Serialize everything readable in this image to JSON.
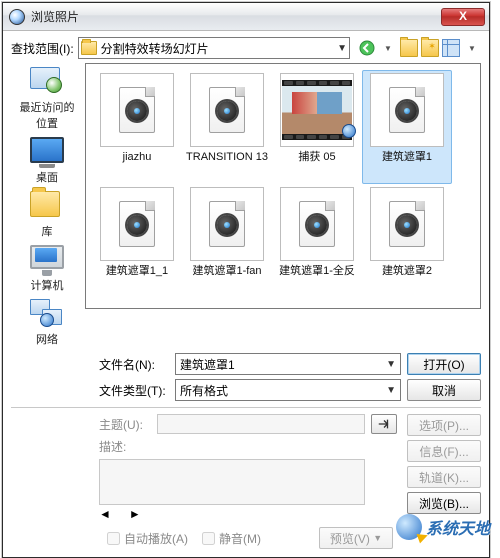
{
  "title": "浏览照片",
  "lookin": {
    "label": "查找范围(I):",
    "folder": "分割特效转场幻灯片"
  },
  "places": {
    "recent": "最近访问的位置",
    "desktop": "桌面",
    "libraries": "库",
    "computer": "计算机",
    "network": "网络"
  },
  "files": [
    {
      "label": "jiazhu",
      "type": "doc"
    },
    {
      "label": "TRANSITION 13",
      "type": "doc"
    },
    {
      "label": "捕获 05",
      "type": "video"
    },
    {
      "label": "建筑遮罩1",
      "type": "doc",
      "selected": true
    },
    {
      "label": "建筑遮罩1_1",
      "type": "doc"
    },
    {
      "label": "建筑遮罩1-fan",
      "type": "doc"
    },
    {
      "label": "建筑遮罩1-全反",
      "type": "doc"
    },
    {
      "label": "建筑遮罩2",
      "type": "doc"
    }
  ],
  "filename_label": "文件名(N):",
  "filename_value": "建筑遮罩1",
  "filetype_label": "文件类型(T):",
  "filetype_value": "所有格式",
  "open_btn": "打开(O)",
  "cancel_btn": "取消",
  "subject_label": "主题(U):",
  "desc_label": "描述:",
  "options_btn": "选项(P)...",
  "info_btn": "信息(F)...",
  "track_btn": "轨道(K)...",
  "browse_btn": "浏览(B)...",
  "preview_btn": "预览(V)",
  "autoplay_label": "自动播放(A)",
  "mute_label": "静音(M)",
  "brand": "系统天地"
}
